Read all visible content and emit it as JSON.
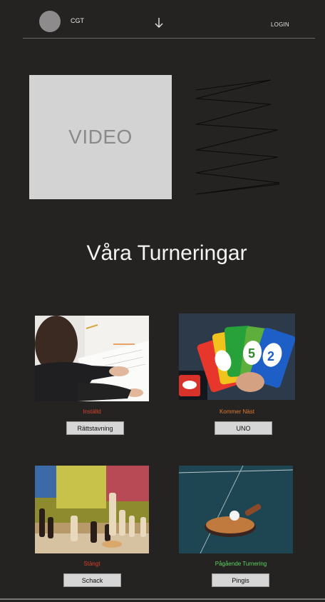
{
  "header": {
    "brand": "CGT",
    "login_label": "LOGIN"
  },
  "hero": {
    "video_label": "VIDEO"
  },
  "section": {
    "title": "Våra Turneringar"
  },
  "tournaments": [
    {
      "status": "Inställd",
      "status_color": "#d9412b",
      "button_label": "Rättstavning"
    },
    {
      "status": "Kommer Näst",
      "status_color": "#e07a2a",
      "button_label": "UNO"
    },
    {
      "status": "Stängt",
      "status_color": "#d9412b",
      "button_label": "Schack"
    },
    {
      "status": "Pågående Turnering",
      "status_color": "#5fd35f",
      "button_label": "Pingis"
    }
  ]
}
